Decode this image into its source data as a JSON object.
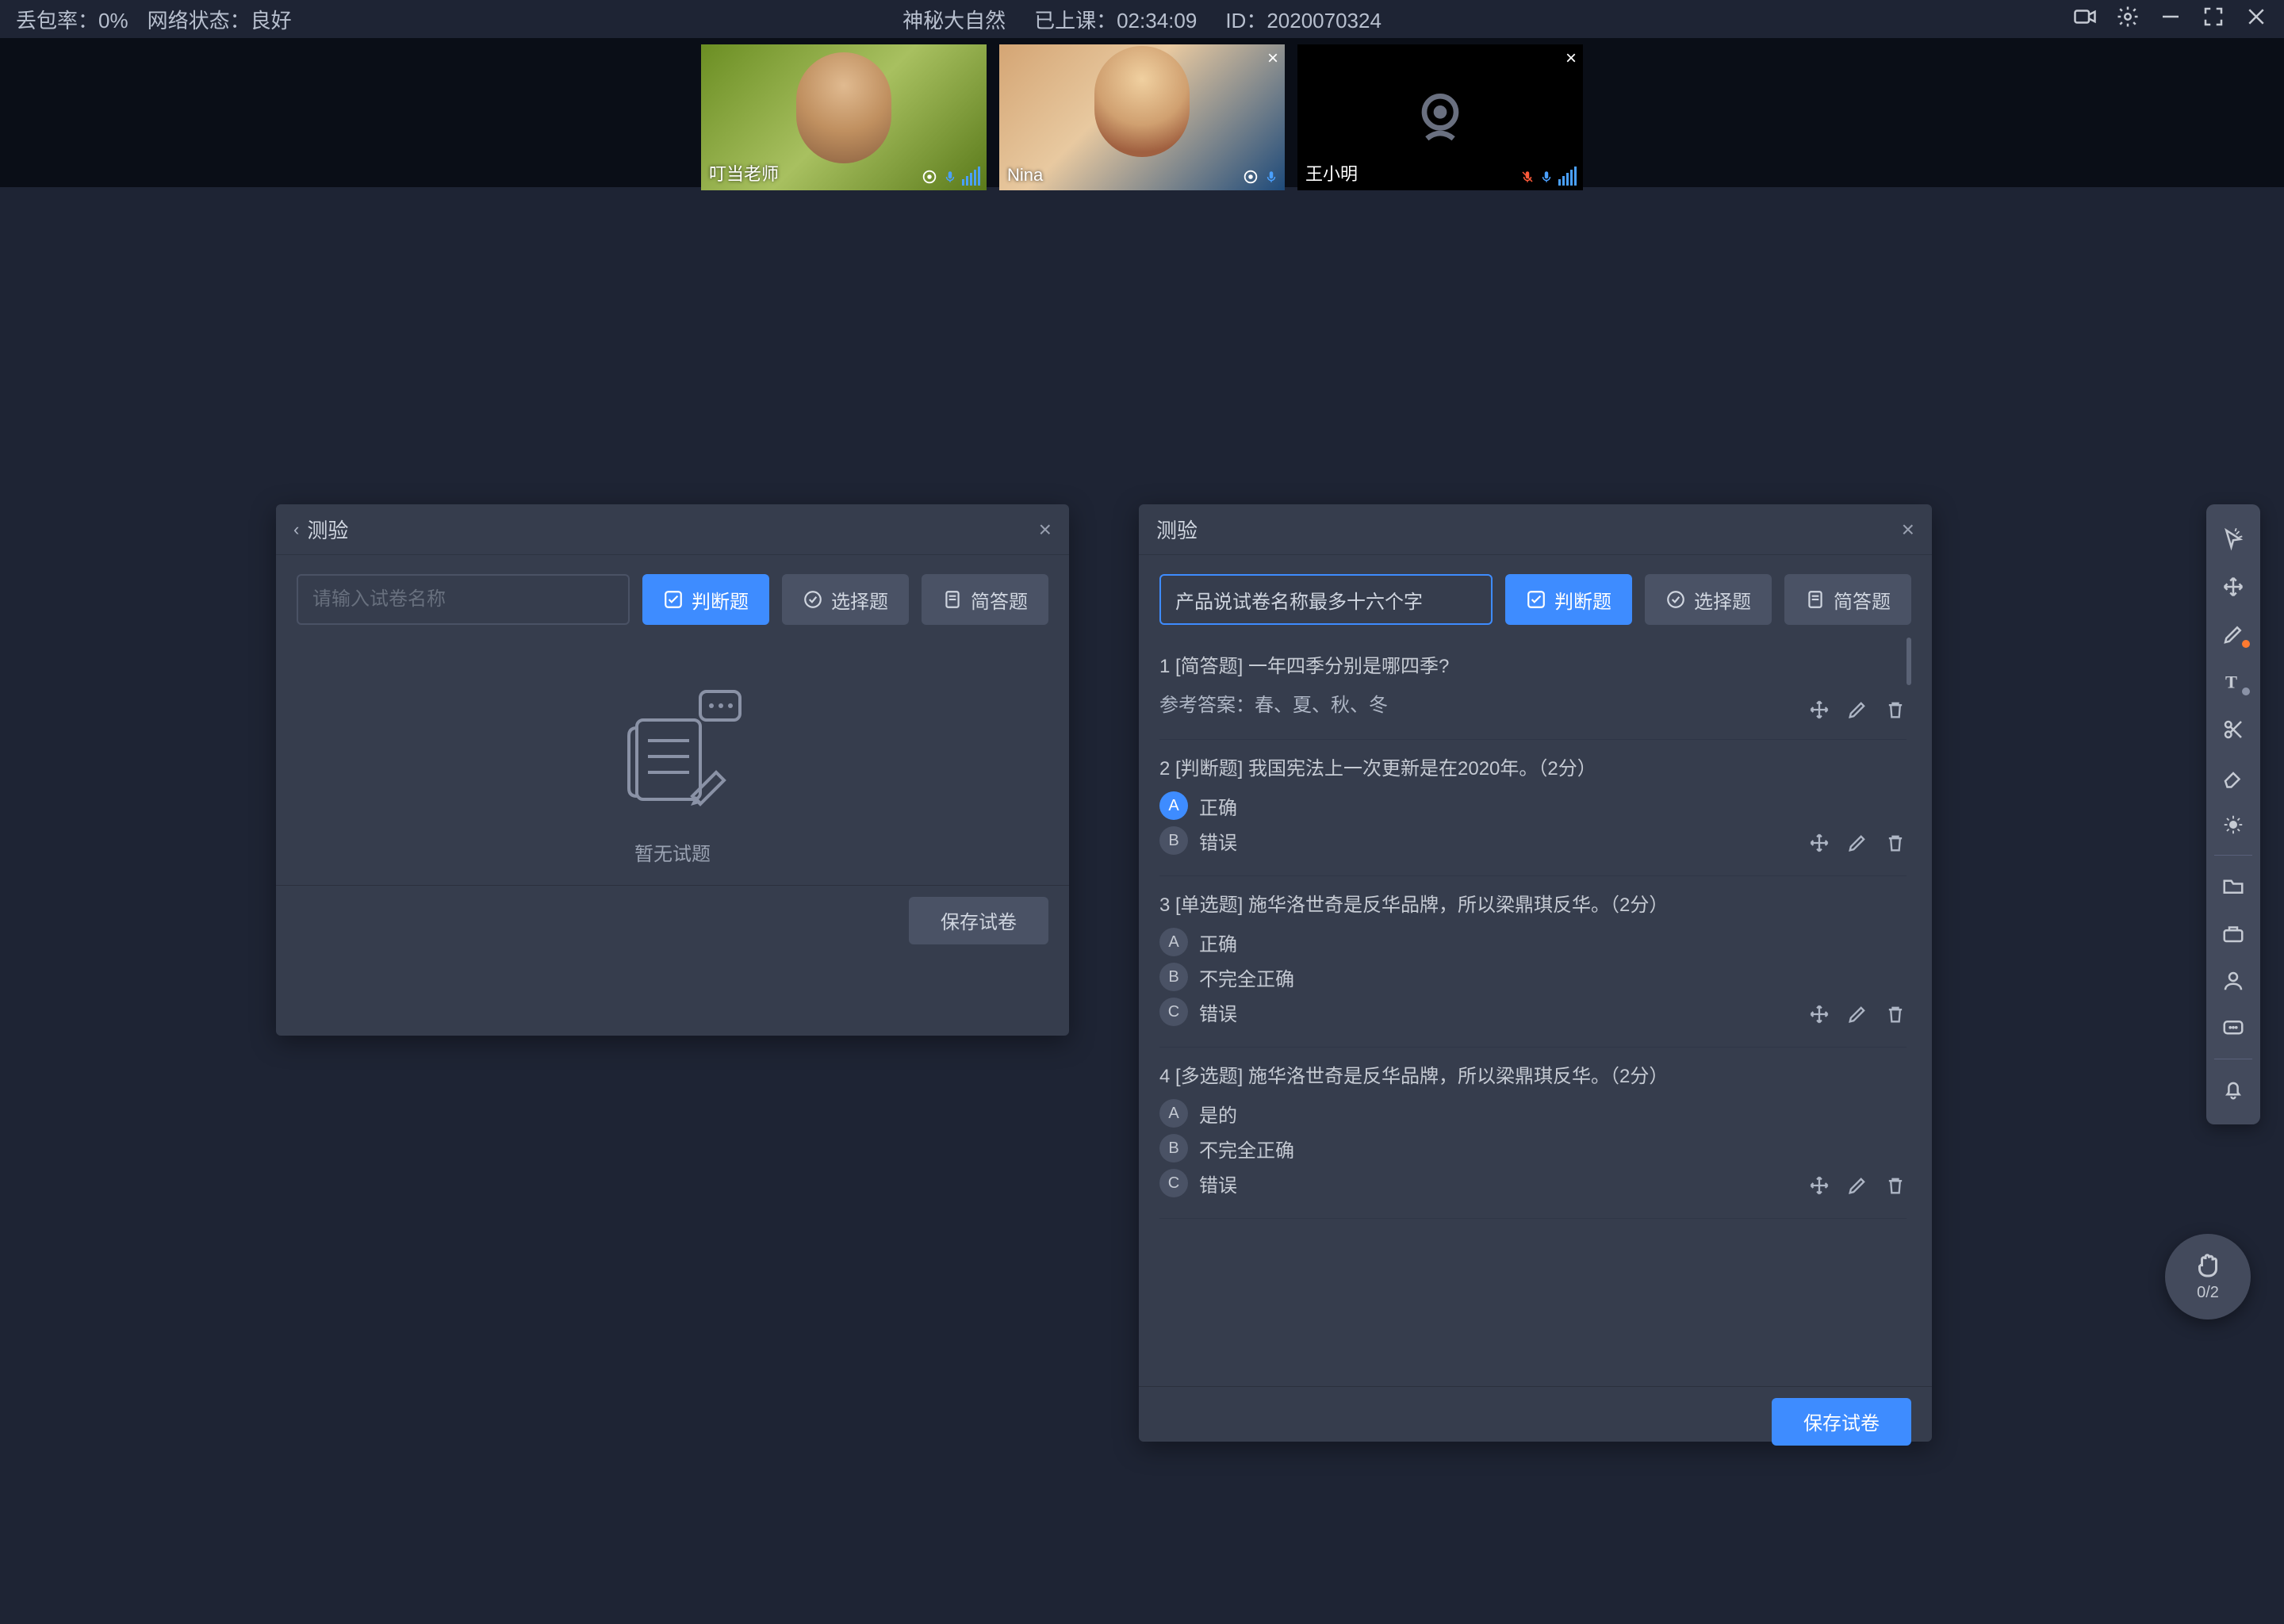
{
  "top": {
    "loss_label": "丢包率：0%",
    "net_label": "网络状态：良好",
    "title": "神秘大自然",
    "elapsed_label": "已上课：",
    "elapsed": "02:34:09",
    "id_label": "ID：",
    "id": "2020070324"
  },
  "participants": [
    {
      "name": "叮当老师",
      "has_close": false,
      "cam_on": true
    },
    {
      "name": "Nina",
      "has_close": true,
      "cam_on": true
    },
    {
      "name": "王小明",
      "has_close": true,
      "cam_on": false
    }
  ],
  "panel_left": {
    "title": "测验",
    "placeholder": "请输入试卷名称",
    "btn_judge": "判断题",
    "btn_choice": "选择题",
    "btn_short": "简答题",
    "empty_text": "暂无试题",
    "save_label": "保存试卷"
  },
  "panel_right": {
    "title": "测验",
    "name_value": "产品说试卷名称最多十六个字",
    "btn_judge": "判断题",
    "btn_choice": "选择题",
    "btn_short": "简答题",
    "save_label": "保存试卷",
    "questions": [
      {
        "num": "1",
        "tag": "[简答题]",
        "text": "一年四季分别是哪四季?",
        "ref_label": "参考答案：",
        "ref_answer": "春、夏、秋、冬",
        "options": []
      },
      {
        "num": "2",
        "tag": "[判断题]",
        "text": "我国宪法上一次更新是在2020年。（2分）",
        "options": [
          {
            "letter": "A",
            "label": "正确",
            "selected": true
          },
          {
            "letter": "B",
            "label": "错误",
            "selected": false
          }
        ]
      },
      {
        "num": "3",
        "tag": "[单选题]",
        "text": "施华洛世奇是反华品牌，所以梁鼎琪反华。（2分）",
        "options": [
          {
            "letter": "A",
            "label": "正确",
            "selected": false
          },
          {
            "letter": "B",
            "label": "不完全正确",
            "selected": false
          },
          {
            "letter": "C",
            "label": "错误",
            "selected": false
          }
        ]
      },
      {
        "num": "4",
        "tag": "[多选题]",
        "text": "施华洛世奇是反华品牌，所以梁鼎琪反华。（2分）",
        "options": [
          {
            "letter": "A",
            "label": "是的",
            "selected": false
          },
          {
            "letter": "B",
            "label": "不完全正确",
            "selected": false
          },
          {
            "letter": "C",
            "label": "错误",
            "selected": false
          }
        ]
      }
    ]
  },
  "toolbar": {
    "tools": [
      "cursor-icon",
      "move-icon",
      "pen-icon",
      "text-icon",
      "scissors-icon",
      "eraser-icon",
      "laser-icon",
      "folder-icon",
      "toolbox-icon",
      "user-icon",
      "chat-icon",
      "bell-icon"
    ]
  },
  "hand": {
    "count": "0/2"
  }
}
